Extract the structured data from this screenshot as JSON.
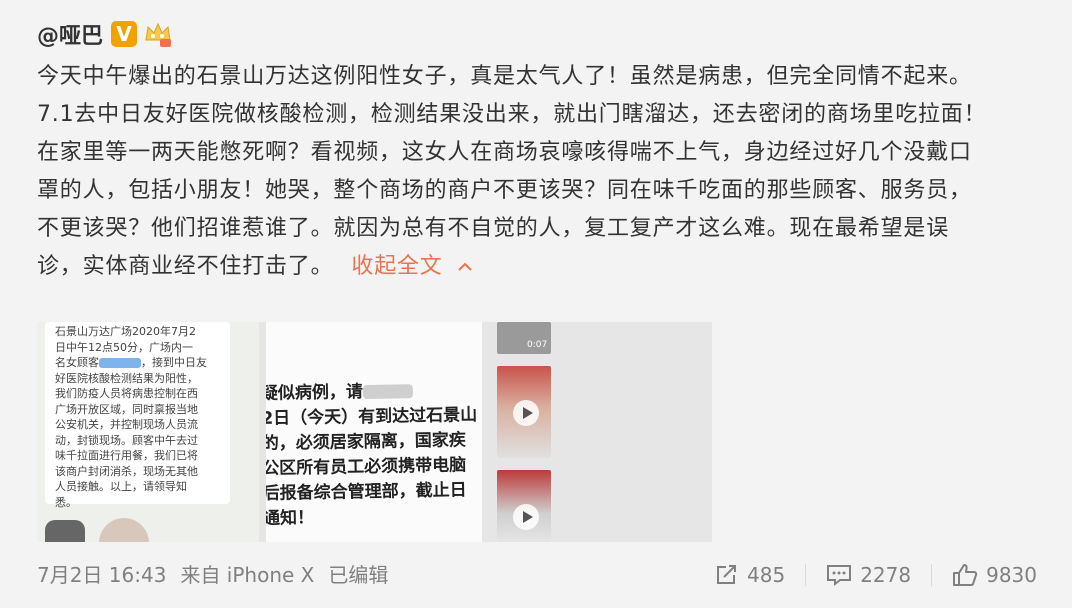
{
  "post": {
    "username": "@哑巴",
    "verified_badge": "V",
    "paragraphs": [
      "今天中午爆出的石景山万达这例阳性女子，真是太气人了！虽然是病患，但完全同情不起来。",
      "7.1去中日友好医院做核酸检测，检测结果没出来，就出门瞎溜达，还去密闭的商场里吃拉面！",
      "在家里等一两天能憋死啊？看视频，这女人在商场哀嚎咳得喘不上气，身边经过好几个没戴口",
      "罩的人，包括小朋友！她哭，整个商场的商户不更该哭？同在味千吃面的那些顾客、服务员，",
      "不更该哭？他们招谁惹谁了。就因为总有不自觉的人，复工复产才这么难。现在最希望是误"
    ],
    "last_line": "诊，实体商业经不住打击了。",
    "collapse_label": "收起全文",
    "collapse_icon": "chevron-up-icon",
    "accent_color": "#eb7350",
    "image1_lines": [
      "石景山万达广场2020年7月2",
      "日中午12点50分，广场内一",
      "名女顾客",
      "，接到中日友",
      "好医院核酸检测结果为阳性，",
      "我们防疫人员将病患控制在西",
      "广场开放区域，同时禀报当地",
      "公安机关，并控制现场人员流",
      "动，封锁现场。顾客中午去过",
      "味千拉面进行用餐，我们已将",
      "该商户封闭消杀，现场无其他",
      "人员接触。以上，请领导知",
      "悉。"
    ],
    "image2_lines": [
      "疑似病例，请",
      "2日（今天）有到达过石景山",
      "的，必须居家隔离，国家疾",
      "公区所有员工必须携带电脑",
      "后报备综合管理部，截止日",
      "通知！"
    ],
    "video_durations": [
      "0:07"
    ],
    "footer": {
      "date": "7月2日 16:43",
      "source": "来自 iPhone X",
      "edited": "已编辑",
      "repost_count": "485",
      "comment_count": "2278",
      "like_count": "9830"
    }
  }
}
